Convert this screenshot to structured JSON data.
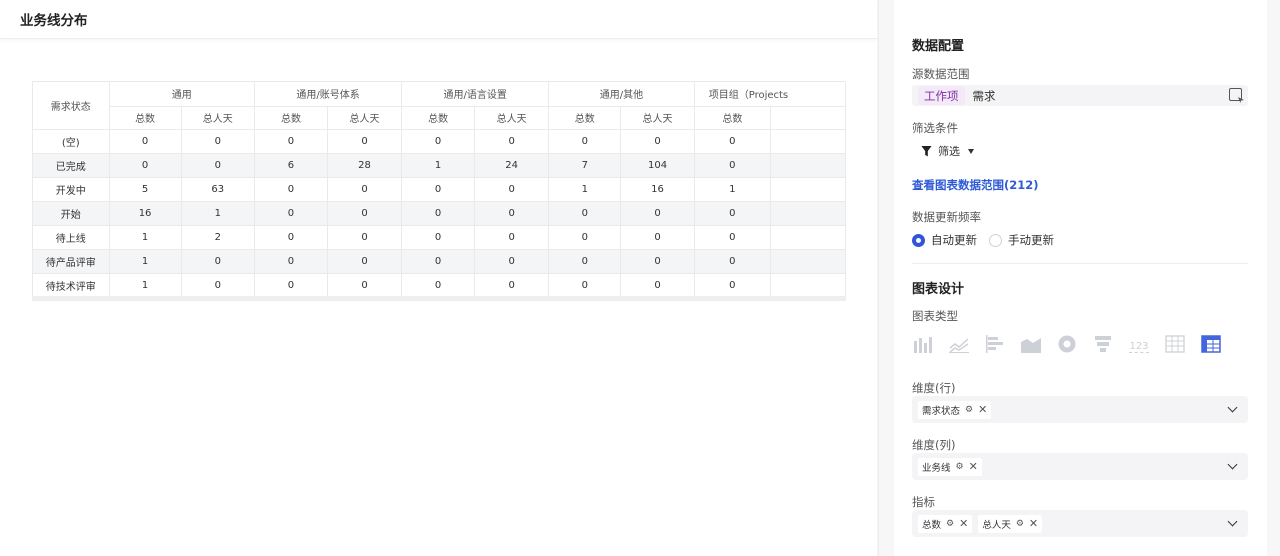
{
  "header": {
    "title": "业务线分布"
  },
  "table": {
    "row_dimension_label": "需求状态",
    "groups": [
      "通用",
      "通用/账号体系",
      "通用/语言设置",
      "通用/其他",
      "项目组（Projects"
    ],
    "metrics": [
      "总数",
      "总人天"
    ],
    "rows": [
      {
        "label": "(空)",
        "cells": [
          "0",
          "0",
          "0",
          "0",
          "0",
          "0",
          "0",
          "0",
          "0"
        ]
      },
      {
        "label": "已完成",
        "cells": [
          "0",
          "0",
          "6",
          "28",
          "1",
          "24",
          "7",
          "104",
          "0"
        ]
      },
      {
        "label": "开发中",
        "cells": [
          "5",
          "63",
          "0",
          "0",
          "0",
          "0",
          "1",
          "16",
          "1"
        ]
      },
      {
        "label": "开始",
        "cells": [
          "16",
          "1",
          "0",
          "0",
          "0",
          "0",
          "0",
          "0",
          "0"
        ]
      },
      {
        "label": "待上线",
        "cells": [
          "1",
          "2",
          "0",
          "0",
          "0",
          "0",
          "0",
          "0",
          "0"
        ]
      },
      {
        "label": "待产品评审",
        "cells": [
          "1",
          "0",
          "0",
          "0",
          "0",
          "0",
          "0",
          "0",
          "0"
        ]
      },
      {
        "label": "待技术评审",
        "cells": [
          "1",
          "0",
          "0",
          "0",
          "0",
          "0",
          "0",
          "0",
          "0"
        ]
      }
    ]
  },
  "config": {
    "data_section_title": "数据配置",
    "source_label": "源数据范围",
    "source_tag": "工作项",
    "source_value": "需求",
    "filter_label": "筛选条件",
    "filter_button": "筛选",
    "view_range_link": "查看图表数据范围(212)",
    "refresh_label": "数据更新频率",
    "refresh_auto": "自动更新",
    "refresh_manual": "手动更新",
    "design_section_title": "图表设计",
    "chart_type_label": "图表类型",
    "chart_types": [
      "bar-chart-icon",
      "line-chart-icon",
      "horizontal-bar-icon",
      "area-chart-icon",
      "donut-chart-icon",
      "funnel-chart-icon",
      "number-card-icon",
      "table-icon",
      "pivot-table-icon"
    ],
    "number_card_text": "123",
    "row_dim_label": "维度(行)",
    "row_dim_chip": "需求状态",
    "col_dim_label": "维度(列)",
    "col_dim_chip": "业务线",
    "metric_label": "指标",
    "metric_chips": [
      "总数",
      "总人天"
    ],
    "accent_color": "#3055d8"
  }
}
